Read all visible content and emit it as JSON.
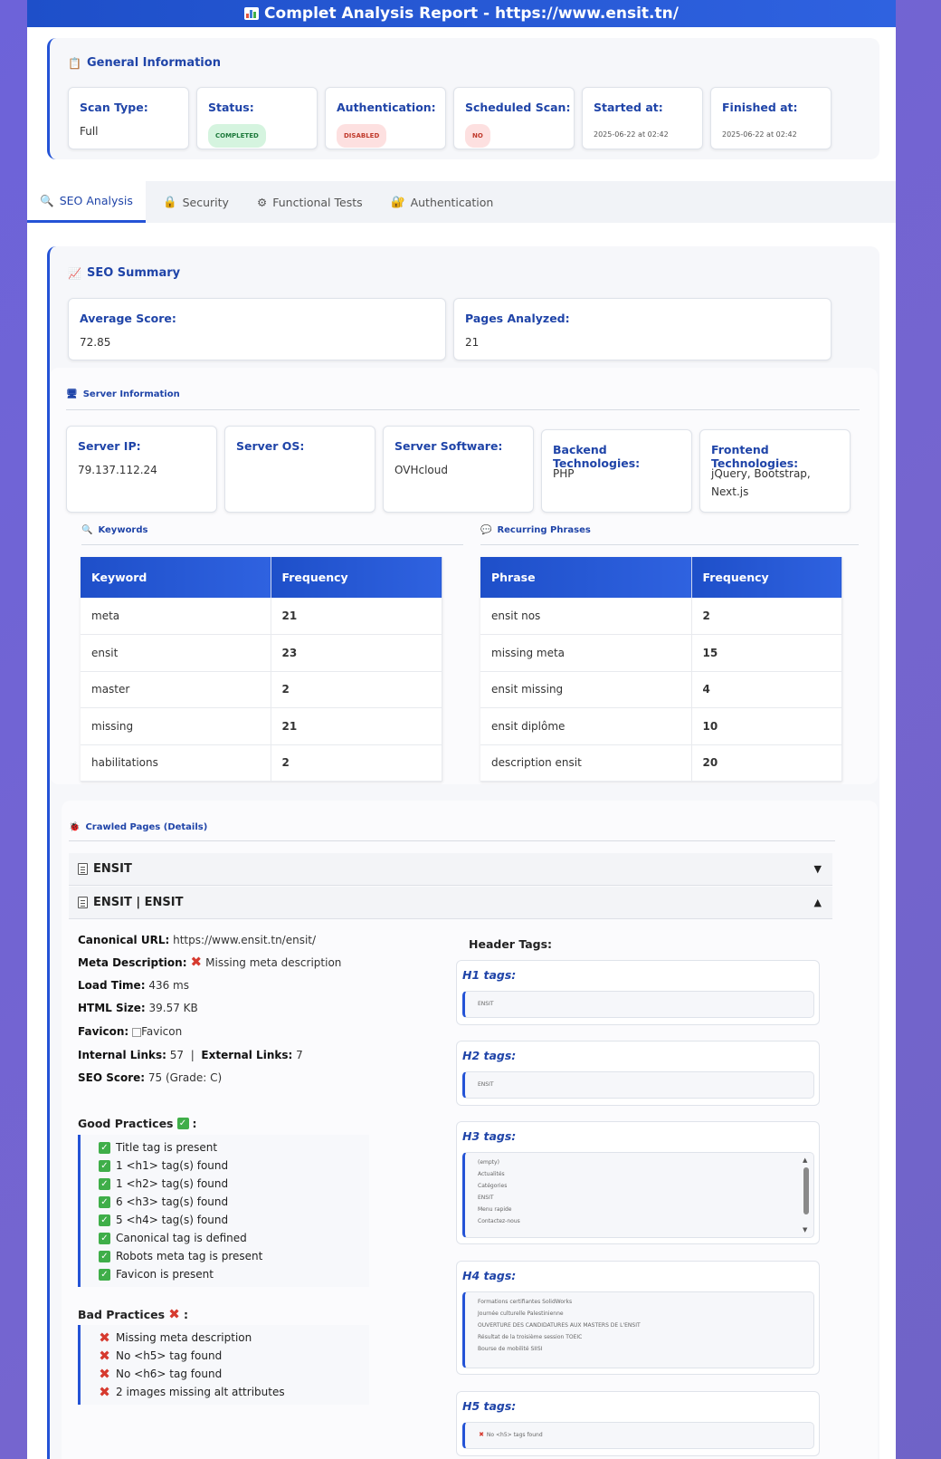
{
  "header": {
    "title": "Complet Analysis Report - https://www.ensit.tn/"
  },
  "general": {
    "title": "General Information",
    "boxes": [
      {
        "label": "Scan Type:",
        "value": "Full"
      },
      {
        "label": "Status:",
        "value": "COMPLETED"
      },
      {
        "label": "Authentication:",
        "value": "DISABLED"
      },
      {
        "label": "Scheduled Scan:",
        "value": "NO"
      },
      {
        "label": "Started at:",
        "value": "2025-06-22 at 02:42"
      },
      {
        "label": "Finished at:",
        "value": "2025-06-22 at 02:42"
      }
    ]
  },
  "tabs": [
    {
      "label": "SEO Analysis",
      "icon": "magnifier-icon"
    },
    {
      "label": "Security",
      "icon": "lock-icon"
    },
    {
      "label": "Functional Tests",
      "icon": "gear-icon"
    },
    {
      "label": "Authentication",
      "icon": "key-lock-icon"
    }
  ],
  "seo_summary": {
    "title": "SEO Summary",
    "average_label": "Average Score:",
    "average_value": "72.85",
    "pages_label": "Pages Analyzed:",
    "pages_value": "21"
  },
  "server": {
    "title": "Server Information",
    "ip_label": "Server IP:",
    "ip_value": "79.137.112.24",
    "os_label": "Server OS:",
    "os_value": "",
    "software_label": "Server Software:",
    "software_value": "OVHcloud",
    "backend_label": "Backend Technologies:",
    "backend_value": "PHP",
    "frontend_label": "Frontend Technologies:",
    "frontend_value": "jQuery, Bootstrap, Next.js"
  },
  "keywords": {
    "title": "Keywords",
    "col1": "Keyword",
    "col2": "Frequency",
    "rows": [
      {
        "k": "meta",
        "f": "21"
      },
      {
        "k": "ensit",
        "f": "23"
      },
      {
        "k": "master",
        "f": "2"
      },
      {
        "k": "missing",
        "f": "21"
      },
      {
        "k": "habilitations",
        "f": "2"
      }
    ]
  },
  "phrases": {
    "title": "Recurring Phrases",
    "col1": "Phrase",
    "col2": "Frequency",
    "rows": [
      {
        "k": "ensit nos",
        "f": "2"
      },
      {
        "k": "missing meta",
        "f": "15"
      },
      {
        "k": "ensit missing",
        "f": "4"
      },
      {
        "k": "ensit diplôme",
        "f": "10"
      },
      {
        "k": "description ensit",
        "f": "20"
      }
    ]
  },
  "crawled": {
    "title": "Crawled Pages (Details)",
    "page1": "ENSIT",
    "page2": "ENSIT | ENSIT",
    "canonical_label": "Canonical URL:",
    "canonical_value": "https://www.ensit.tn/ensit/",
    "meta_label": "Meta Description:",
    "meta_value": "Missing meta description",
    "load_label": "Load Time:",
    "load_value": "436 ms",
    "html_label": "HTML Size:",
    "html_value": "39.57 KB",
    "favicon_label": "Favicon:",
    "favicon_value": "Favicon",
    "internal_label": "Internal Links:",
    "internal_value": "57",
    "external_label": "External Links:",
    "external_value": "7",
    "seo_label": "SEO Score:",
    "seo_value": "75 (Grade: C)",
    "good_title": "Good Practices",
    "good": [
      "Title tag is present",
      "1 <h1> tag(s) found",
      "1 <h2> tag(s) found",
      "6 <h3> tag(s) found",
      "5 <h4> tag(s) found",
      "Canonical tag is defined",
      "Robots meta tag is present",
      "Favicon is present"
    ],
    "bad_title": "Bad Practices",
    "bad": [
      "Missing meta description",
      "No <h5> tag found",
      "No <h6> tag found",
      "2 images missing alt attributes"
    ],
    "header_tags_title": "Header Tags:",
    "h1_title": "H1 tags:",
    "h1": [
      "ENSIT"
    ],
    "h2_title": "H2 tags:",
    "h2": [
      "ENSIT"
    ],
    "h3_title": "H3 tags:",
    "h3": [
      "(empty)",
      "Actualités",
      "Catégories",
      "ENSIT",
      "Menu rapide",
      "Contactez-nous"
    ],
    "h4_title": "H4 tags:",
    "h4": [
      "Formations certifiantes SolidWorks",
      "Journée culturelle Palestinienne",
      "OUVERTURE DES CANDIDATURES AUX MASTERS DE L'ENSIT",
      "Résultat de la troisième session TOEIC",
      "Bourse de mobilité SIISI"
    ],
    "h5_title": "H5 tags:",
    "h5": [
      "No <h5> tags found"
    ]
  }
}
